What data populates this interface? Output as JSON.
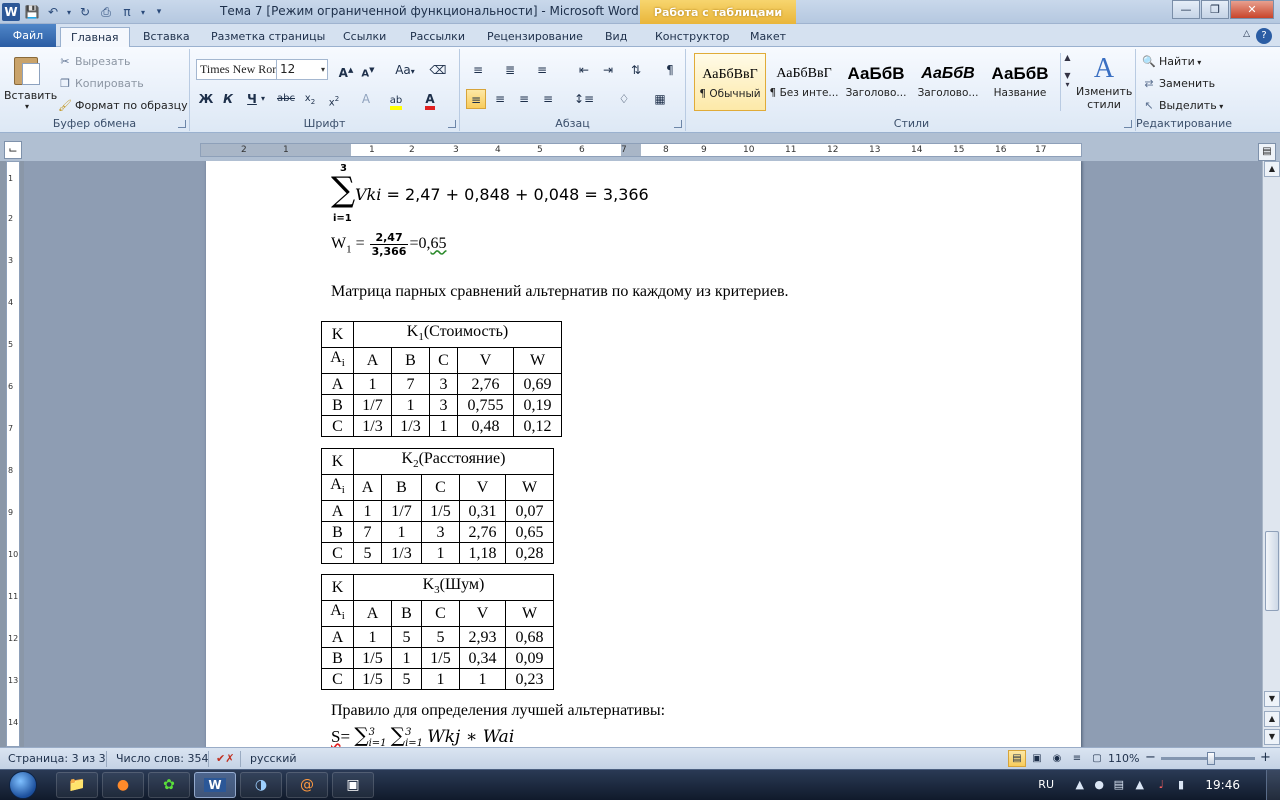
{
  "titlebar": {
    "title": "Тема 7 [Режим ограниченной функциональности]  -  Microsoft Word",
    "context_tab": "Работа с таблицами",
    "app_logo": "W"
  },
  "tabs": {
    "file": "Файл",
    "items": [
      "Главная",
      "Вставка",
      "Разметка страницы",
      "Ссылки",
      "Рассылки",
      "Рецензирование",
      "Вид",
      "Конструктор",
      "Макет"
    ],
    "active": "Главная"
  },
  "clipboard": {
    "paste": "Вставить",
    "cut": "Вырезать",
    "copy": "Копировать",
    "format_painter": "Формат по образцу",
    "label": "Буфер обмена"
  },
  "font": {
    "name": "Times New Roman",
    "size": "12",
    "label": "Шрифт"
  },
  "paragraph": {
    "label": "Абзац"
  },
  "styles": {
    "items": [
      {
        "preview": "АаБбВвГ",
        "name": "¶ Обычный"
      },
      {
        "preview": "АаБбВвГ",
        "name": "¶ Без инте..."
      },
      {
        "preview": "АаБбВ",
        "name": "Заголово..."
      },
      {
        "preview": "АаБбВ",
        "name": "Заголово..."
      },
      {
        "preview": "АаБбВ",
        "name": "Название"
      }
    ],
    "change_styles": "Изменить стили",
    "label": "Стили"
  },
  "editing": {
    "find": "Найти",
    "replace": "Заменить",
    "select": "Выделить",
    "label": "Редактирование"
  },
  "ruler": {
    "numbers": [
      "1",
      "2",
      "1",
      "2",
      "3",
      "4",
      "5",
      "6",
      "7",
      "8",
      "9",
      "10",
      "11",
      "12",
      "13",
      "14",
      "15",
      "16",
      "17"
    ],
    "vnumbers": [
      "1",
      "2",
      "3",
      "4",
      "5",
      "6",
      "7",
      "8",
      "9",
      "10",
      "11",
      "12",
      "13",
      "14"
    ]
  },
  "document": {
    "sum_top": "3",
    "sum_bottom": "i=1",
    "formula_var": "Vki",
    "formula_rhs": " = 2,47 + 0,848 + 0,048 = 3,366",
    "w1_label": "W",
    "w1_sub": "1",
    "w1_eq": " = ",
    "w1_num": "2,47",
    "w1_den": "3,366",
    "w1_eq2": "=0,",
    "w1_val": "65",
    "matrix_intro": "Матрица парных сравнений альтернатив по каждому из критериев.",
    "rule_intro": "Правило для определения лучшей альтернативы:",
    "rule_prefix": "S",
    "rule_eq": "= ",
    "rule_sum1": "∑",
    "rule_lim_top": "3",
    "rule_lim_bot": "i=1",
    "rule_sum2": "∑",
    "rule_lim_top2": "3",
    "rule_lim_bot2": "i=1",
    "rule_body": "Wkj ∗ Wai"
  },
  "tables": [
    {
      "corner": "K",
      "title": "K",
      "title_sub": "1",
      "title_rest": "(Стоимость)",
      "header": [
        "A",
        "B",
        "C",
        "V",
        "W"
      ],
      "ai": "A",
      "ai_sub": "i",
      "rows": [
        [
          "A",
          "1",
          "7",
          "3",
          "2,76",
          "0,69"
        ],
        [
          "B",
          "1/7",
          "1",
          "3",
          "0,755",
          "0,19"
        ],
        [
          "C",
          "1/3",
          "1/3",
          "1",
          "0,48",
          "0,12"
        ]
      ]
    },
    {
      "corner": "K",
      "title": "K",
      "title_sub": "2",
      "title_rest": "(Расстояние)",
      "header": [
        "A",
        "B",
        "C",
        "V",
        "W"
      ],
      "ai": "A",
      "ai_sub": "i",
      "rows": [
        [
          "A",
          "1",
          "1/7",
          "1/5",
          "0,31",
          "0,07"
        ],
        [
          "B",
          "7",
          "1",
          "3",
          "2,76",
          "0,65"
        ],
        [
          "C",
          "5",
          "1/3",
          "1",
          "1,18",
          "0,28"
        ]
      ]
    },
    {
      "corner": "K",
      "title": "K",
      "title_sub": "3",
      "title_rest": "(Шум)",
      "header": [
        "A",
        "B",
        "C",
        "V",
        "W"
      ],
      "ai": "A",
      "ai_sub": "i",
      "rows": [
        [
          "A",
          "1",
          "5",
          "5",
          "2,93",
          "0,68"
        ],
        [
          "B",
          "1/5",
          "1",
          "1/5",
          "0,34",
          "0,09"
        ],
        [
          "C",
          "1/5",
          "5",
          "1",
          "1",
          "0,23"
        ]
      ]
    }
  ],
  "statusbar": {
    "page": "Страница: 3 из 3",
    "words": "Число слов: 354",
    "language": "русский",
    "zoom": "110%",
    "zoom_minus": "−",
    "zoom_plus": "+"
  },
  "taskbar": {
    "lang": "RU",
    "time": "19:46"
  }
}
